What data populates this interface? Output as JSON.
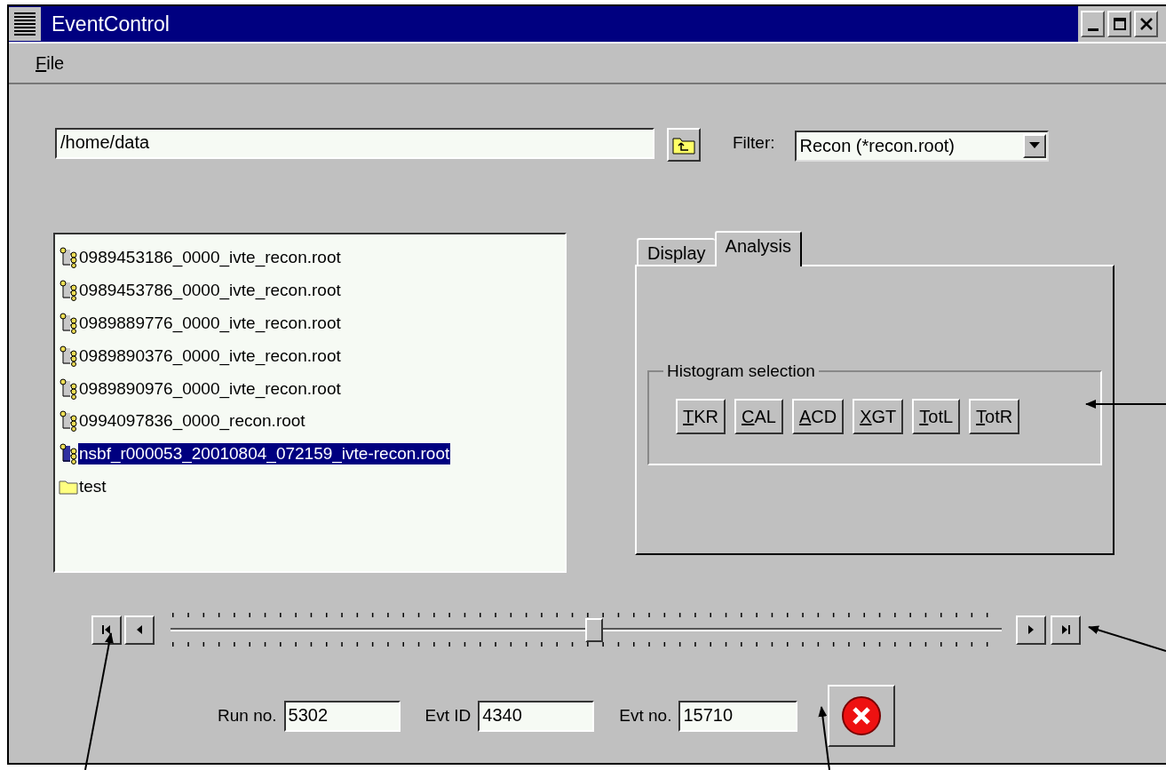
{
  "window": {
    "title": "EventControl"
  },
  "menu": [
    {
      "label": "File",
      "mnemonic": true
    }
  ],
  "path_field": {
    "value": "/home/data"
  },
  "filter": {
    "label": "Filter:",
    "value": "Recon (*recon.root)"
  },
  "files": [
    {
      "name": "0989453186_0000_ivte_recon.root",
      "kind": "root_file",
      "selected": false
    },
    {
      "name": "0989453786_0000_ivte_recon.root",
      "kind": "root_file",
      "selected": false
    },
    {
      "name": "0989889776_0000_ivte_recon.root",
      "kind": "root_file",
      "selected": false
    },
    {
      "name": "0989890376_0000_ivte_recon.root",
      "kind": "root_file",
      "selected": false
    },
    {
      "name": "0989890976_0000_ivte_recon.root",
      "kind": "root_file",
      "selected": false
    },
    {
      "name": "0994097836_0000_recon.root",
      "kind": "root_file",
      "selected": false
    },
    {
      "name": "nsbf_r000053_20010804_072159_ivte-recon.root",
      "kind": "root_file",
      "selected": true
    },
    {
      "name": "test",
      "kind": "folder",
      "selected": false
    }
  ],
  "tabs": [
    {
      "label": "Display",
      "selected": false
    },
    {
      "label": "Analysis",
      "selected": true
    }
  ],
  "histogram_selection": {
    "title": "Histogram selection",
    "buttons": [
      {
        "label": "TKR",
        "mnemonic": true
      },
      {
        "label": "CAL",
        "mnemonic": true
      },
      {
        "label": "ACD",
        "mnemonic": true
      },
      {
        "label": "XGT",
        "mnemonic": true
      },
      {
        "label": "TotL",
        "mnemonic": true
      },
      {
        "label": "TotR",
        "mnemonic": true
      }
    ]
  },
  "event_slider": {
    "level": 0.51
  },
  "fields": [
    {
      "label": "Run no.",
      "value": "5302"
    },
    {
      "label": "Evt ID",
      "value": "4340"
    },
    {
      "label": "Evt no.",
      "value": "15710"
    }
  ]
}
